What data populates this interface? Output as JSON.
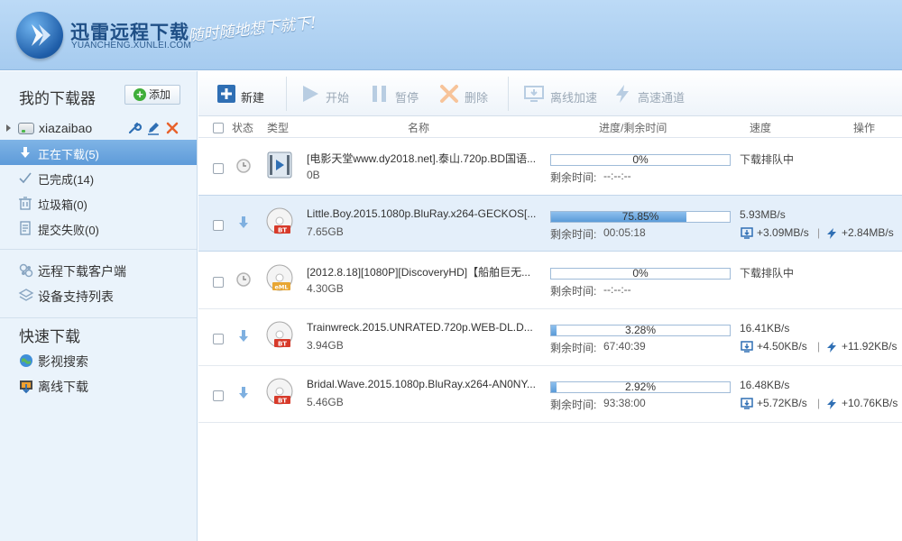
{
  "header": {
    "title": "迅雷远程下载",
    "subtitle": "YUANCHENG.XUNLEI.COM",
    "slogan": "随时随地想下就下!"
  },
  "sidebar": {
    "title": "我的下载器",
    "add_label": "添加",
    "device_name": "xiazaibao",
    "menu": [
      {
        "label": "正在下载(5)",
        "icon": "download-arrow-icon",
        "active": true
      },
      {
        "label": "已完成(14)",
        "icon": "check-icon",
        "active": false
      },
      {
        "label": "垃圾箱(0)",
        "icon": "trash-icon",
        "active": false
      },
      {
        "label": "提交失败(0)",
        "icon": "document-icon",
        "active": false
      }
    ],
    "links": [
      {
        "label": "远程下载客户端",
        "icon": "link-icon"
      },
      {
        "label": "设备支持列表",
        "icon": "layers-icon"
      }
    ],
    "quick_title": "快速下载",
    "quick_links": [
      {
        "label": "影视搜索",
        "icon": "globe-icon"
      },
      {
        "label": "离线下载",
        "icon": "offline-download-icon"
      }
    ]
  },
  "toolbar": {
    "new_label": "新建",
    "start_label": "开始",
    "pause_label": "暂停",
    "delete_label": "删除",
    "offline_accel_label": "离线加速",
    "high_speed_label": "高速通道"
  },
  "table": {
    "headers": {
      "status": "状态",
      "type": "类型",
      "name": "名称",
      "progress": "进度/剩余时间",
      "speed": "速度",
      "action": "操作"
    },
    "remain_label": "剩余时间:",
    "rows": [
      {
        "status": "clock",
        "type": "video",
        "name": "[电影天堂www.dy2018.net].泰山.720p.BD国语...",
        "size": "0B",
        "progress": 0,
        "progress_text": "0%",
        "remaining": "--:--:--",
        "speed": "下载排队中",
        "offline_speed": "",
        "high_speed": ""
      },
      {
        "status": "downloading",
        "type": "bt",
        "name": "Little.Boy.2015.1080p.BluRay.x264-GECKOS[...",
        "size": "7.65GB",
        "progress": 75.85,
        "progress_text": "75.85%",
        "remaining": "00:05:18",
        "speed": "5.93MB/s",
        "offline_speed": "+3.09MB/s",
        "high_speed": "+2.84MB/s"
      },
      {
        "status": "clock",
        "type": "emule",
        "name": "[2012.8.18][1080P][DiscoveryHD]【船舶巨无...",
        "size": "4.30GB",
        "progress": 0,
        "progress_text": "0%",
        "remaining": "--:--:--",
        "speed": "下载排队中",
        "offline_speed": "",
        "high_speed": ""
      },
      {
        "status": "downloading",
        "type": "bt",
        "name": "Trainwreck.2015.UNRATED.720p.WEB-DL.D...",
        "size": "3.94GB",
        "progress": 3.28,
        "progress_text": "3.28%",
        "remaining": "67:40:39",
        "speed": "16.41KB/s",
        "offline_speed": "+4.50KB/s",
        "high_speed": "+11.92KB/s"
      },
      {
        "status": "downloading",
        "type": "bt",
        "name": "Bridal.Wave.2015.1080p.BluRay.x264-AN0NY...",
        "size": "5.46GB",
        "progress": 2.92,
        "progress_text": "2.92%",
        "remaining": "93:38:00",
        "speed": "16.48KB/s",
        "offline_speed": "+5.72KB/s",
        "high_speed": "+10.76KB/s"
      }
    ]
  },
  "colors": {
    "header_bg": "#b3d3f3",
    "sidebar_bg": "#eaf3fb",
    "active_item": "#6aa6de",
    "progress_fill": "#6aa6de",
    "delete_x": "#f2a35a"
  }
}
